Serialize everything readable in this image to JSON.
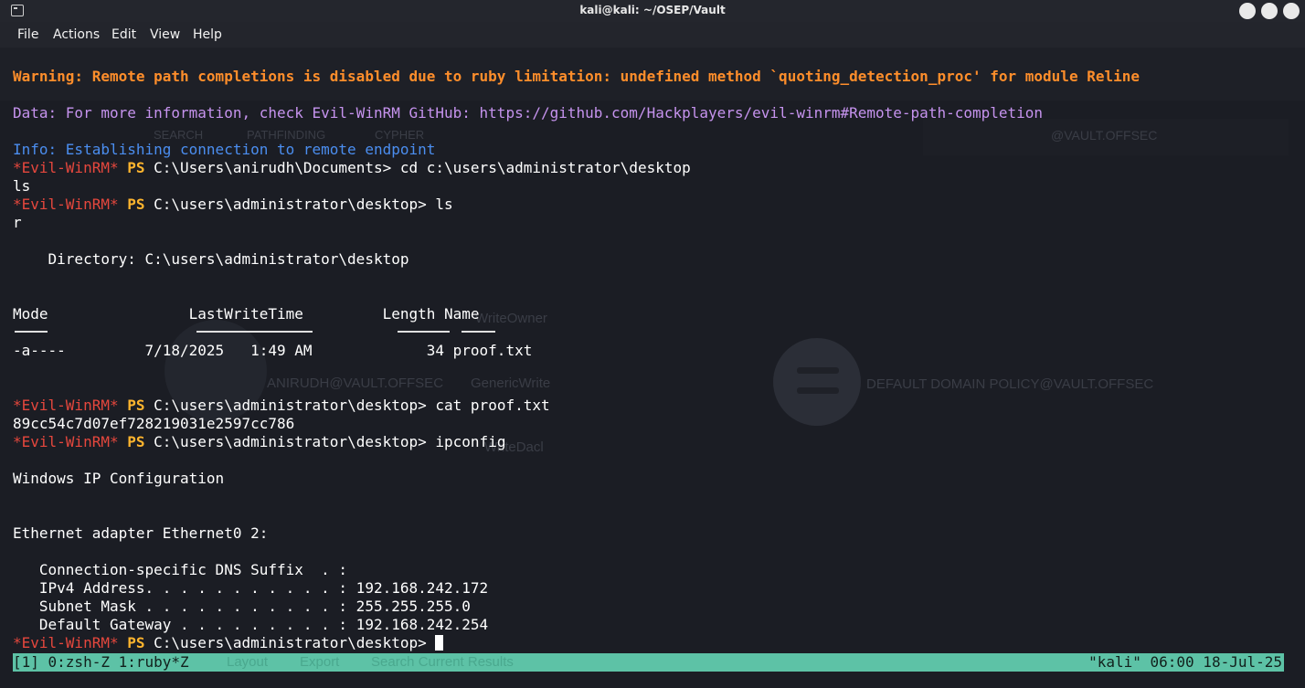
{
  "window": {
    "title": "kali@kali: ~/OSEP/Vault"
  },
  "menu": {
    "items": [
      "File",
      "Actions",
      "Edit",
      "View",
      "Help"
    ]
  },
  "background_ghost": {
    "labels": [
      "WriteOwner",
      "GenericWrite",
      "ANIRUDH@VAULT.OFFSEC",
      "DEFAULT DOMAIN POLICY@VAULT.OFFSEC",
      "WriteDacl",
      "SEARCH",
      "PATHFINDING",
      "CYPHER",
      "@VAULT.OFFSEC"
    ]
  },
  "terminal": {
    "warning": "Warning: Remote path completions is disabled due to ruby limitation: undefined method `quoting_detection_proc' for module Reline",
    "data_line": "Data: For more information, check Evil-WinRM GitHub: https://github.com/Hackplayers/evil-winrm#Remote-path-completion",
    "info_line": "Info: Establishing connection to remote endpoint",
    "prompt_tag": "*Evil-WinRM*",
    "prompt_ps": "PS",
    "cmd1": "C:\\Users\\anirudh\\Documents> cd c:\\users\\administrator\\desktop",
    "out1": "ls",
    "cmd2": "C:\\users\\administrator\\desktop> ls",
    "out2": "r",
    "directory_line": "    Directory: C:\\users\\administrator\\desktop",
    "table_header": "Mode                LastWriteTime         Length Name",
    "table_row": "-a----         7/18/2025   1:49 AM             34 proof.txt",
    "cmd3": "C:\\users\\administrator\\desktop> cat proof.txt",
    "out3": "89cc54c7d07ef728219031e2597cc786",
    "cmd4": "C:\\users\\administrator\\desktop> ipconfig",
    "ip_title": "Windows IP Configuration",
    "adapter": "Ethernet adapter Ethernet0 2:",
    "dns_suffix": "   Connection-specific DNS Suffix  . :",
    "ipv4": "   IPv4 Address. . . . . . . . . . . : 192.168.242.172",
    "subnet": "   Subnet Mask . . . . . . . . . . . : 255.255.255.0",
    "gateway": "   Default Gateway . . . . . . . . . : 192.168.242.254",
    "cmd5": "C:\\users\\administrator\\desktop> "
  },
  "statusbar": {
    "left": "[1] 0:zsh-Z 1:ruby*Z",
    "right": "\"kali\" 06:00 18-Jul-25",
    "ghost_items": [
      "Layout",
      "Export",
      "Search Current Results"
    ]
  },
  "colors": {
    "warning": "#ff8e2b",
    "data": "#c693ee",
    "info": "#4b8ef0",
    "evil": "#e5473d",
    "ps": "#ffb52e",
    "status_bg": "#5dc2a6"
  }
}
